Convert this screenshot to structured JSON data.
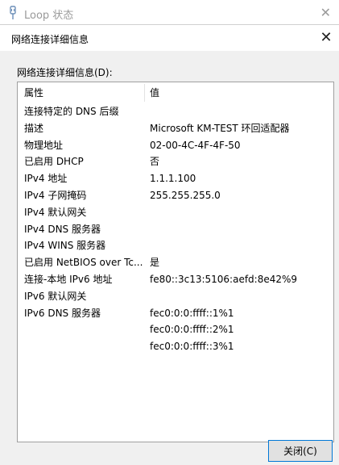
{
  "background_window": {
    "title": "Loop 状态",
    "close_glyph": "✕"
  },
  "dialog": {
    "title": "网络连接详细信息",
    "close_glyph": "✕",
    "section_label": "网络连接详细信息(D):",
    "columns": {
      "property": "属性",
      "value": "值"
    },
    "rows": [
      {
        "property": "连接特定的 DNS 后缀",
        "value": ""
      },
      {
        "property": "描述",
        "value": "Microsoft KM-TEST 环回适配器"
      },
      {
        "property": "物理地址",
        "value": "02-00-4C-4F-4F-50"
      },
      {
        "property": "已启用 DHCP",
        "value": "否"
      },
      {
        "property": "IPv4 地址",
        "value": "1.1.1.100"
      },
      {
        "property": "IPv4 子网掩码",
        "value": "255.255.255.0"
      },
      {
        "property": "IPv4 默认网关",
        "value": ""
      },
      {
        "property": "IPv4 DNS 服务器",
        "value": ""
      },
      {
        "property": "IPv4 WINS 服务器",
        "value": ""
      },
      {
        "property": "已启用 NetBIOS over Tc...",
        "value": "是"
      },
      {
        "property": "连接-本地 IPv6 地址",
        "value": "fe80::3c13:5106:aefd:8e42%9"
      },
      {
        "property": "IPv6 默认网关",
        "value": ""
      },
      {
        "property": "IPv6 DNS 服务器",
        "value": "fec0:0:0:ffff::1%1"
      },
      {
        "property": "",
        "value": "fec0:0:0:ffff::2%1"
      },
      {
        "property": "",
        "value": "fec0:0:0:ffff::3%1"
      }
    ],
    "close_button_label": "关闭(C)"
  },
  "colors": {
    "accent": "#0078d7",
    "dialog_bg": "#f0f0f0",
    "muted_text": "#9a9a9a"
  }
}
